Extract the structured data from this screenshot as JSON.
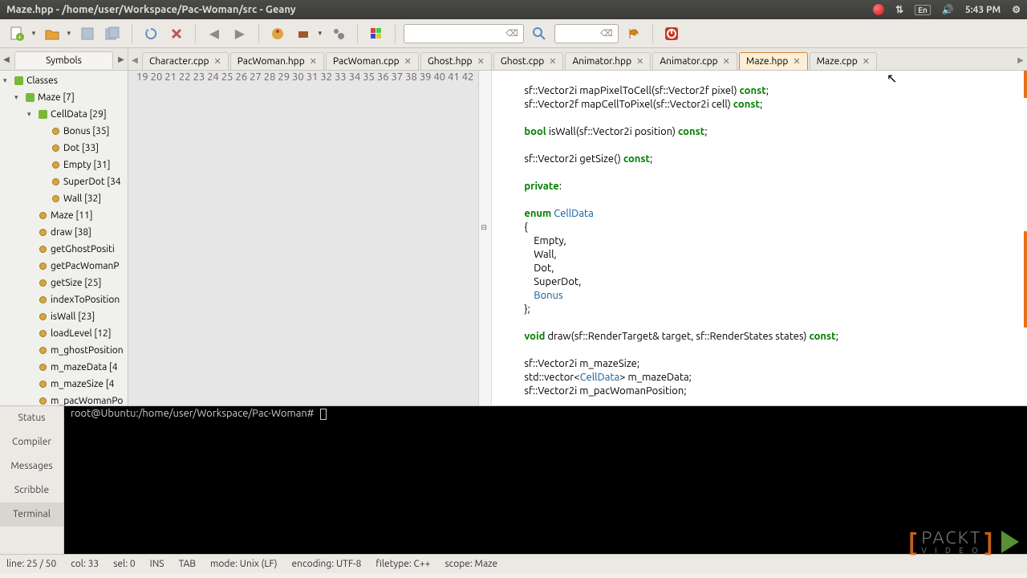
{
  "window": {
    "title": "Maze.hpp - /home/user/Workspace/Pac-Woman/src - Geany"
  },
  "system_tray": {
    "time": "5:43 PM",
    "lang": "En"
  },
  "toolbar": {
    "search1": "",
    "search2": ""
  },
  "sidebar": {
    "tab": "Symbols",
    "tree": {
      "root": "Classes",
      "maze": "Maze [7]",
      "celldata": "CellData [29]",
      "members": [
        "Bonus [35]",
        "Dot [33]",
        "Empty [31]",
        "SuperDot [34",
        "Wall [32]"
      ],
      "methods": [
        "Maze [11]",
        "draw [38]",
        "getGhostPositi",
        "getPacWomanP",
        "getSize [25]",
        "indexToPosition",
        "isWall [23]",
        "loadLevel [12]",
        "m_ghostPosition",
        "m_mazeData [4",
        "m_mazeSize [4",
        "m_pacWomanPo"
      ]
    }
  },
  "tabs": [
    {
      "label": "Character.cpp",
      "active": false
    },
    {
      "label": "PacWoman.hpp",
      "active": false
    },
    {
      "label": "PacWoman.cpp",
      "active": false
    },
    {
      "label": "Ghost.hpp",
      "active": false
    },
    {
      "label": "Ghost.cpp",
      "active": false
    },
    {
      "label": "Animator.hpp",
      "active": false
    },
    {
      "label": "Animator.cpp",
      "active": false
    },
    {
      "label": "Maze.hpp",
      "active": true
    },
    {
      "label": "Maze.cpp",
      "active": false
    }
  ],
  "editor": {
    "first_line": 19,
    "lines": [
      "",
      "    sf::Vector2i mapPixelToCell(sf::Vector2f pixel) <kw>const</kw>;",
      "    sf::Vector2f mapCellToPixel(sf::Vector2i cell) <kw>const</kw>;",
      "",
      "    <kw>bool</kw> isWall(sf::Vector2i position) <kw>const</kw>;",
      "",
      "    sf::Vector2i getSize() <kw>const</kw>;",
      "",
      "    <kw>private</kw>:",
      "",
      "    <kw>enum</kw> <tn>CellData</tn>",
      "    {",
      "        Empty,",
      "        Wall,",
      "        Dot,",
      "        SuperDot,",
      "        <tn>Bonus</tn>",
      "    };",
      "",
      "    <kw>void</kw> draw(sf::RenderTarget& target, sf::RenderStates states) <kw>const</kw>;",
      "",
      "    sf::Vector2i m_mazeSize;",
      "    std::vector<<tn>CellData</tn>> m_mazeData;",
      "    sf::Vector2i m_pacWomanPosition;"
    ]
  },
  "terminal": {
    "prompt": "root@Ubuntu:/home/user/Workspace/Pac-Woman#"
  },
  "msg_tabs": [
    "Status",
    "Compiler",
    "Messages",
    "Scribble",
    "Terminal"
  ],
  "statusbar": {
    "line": "line: 25 / 50",
    "col": "col: 33",
    "sel": "sel: 0",
    "ins": "INS",
    "tab": "TAB",
    "mode": "mode: Unix (LF)",
    "encoding": "encoding: UTF-8",
    "filetype": "filetype: C++",
    "scope": "scope: Maze"
  },
  "watermark": {
    "line1": "PACKT",
    "line2": "V I D E O"
  }
}
